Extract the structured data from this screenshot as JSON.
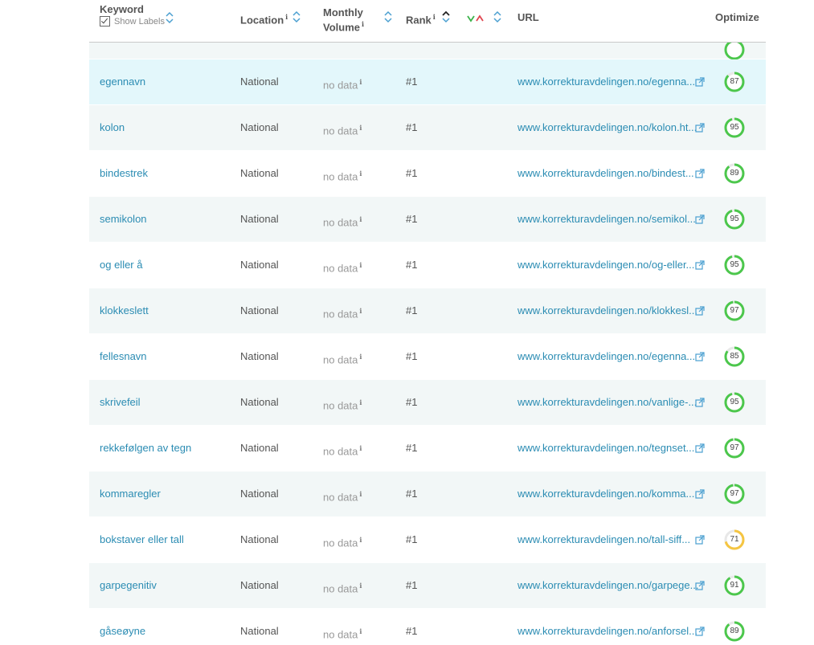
{
  "header": {
    "keyword": "Keyword",
    "show_labels": "Show Labels",
    "location": "Location",
    "monthly_line1": "Monthly",
    "monthly_line2": "Volume",
    "rank": "Rank",
    "url": "URL",
    "optimize": "Optimize",
    "info_glyph": "i"
  },
  "colors": {
    "link": "#2b8cb3",
    "score_green": "#4cc74c",
    "score_yellow": "#f5c542",
    "trend_up": "#3cb34a",
    "trend_down": "#e0454f"
  },
  "rows": [
    {
      "keyword": "egennavn",
      "location": "National",
      "volume": "no data",
      "rank": "#1",
      "url": "www.korrekturavdelingen.no/egenna...",
      "score": 87
    },
    {
      "keyword": "kolon",
      "location": "National",
      "volume": "no data",
      "rank": "#1",
      "url": "www.korrekturavdelingen.no/kolon.ht...",
      "score": 95
    },
    {
      "keyword": "bindestrek",
      "location": "National",
      "volume": "no data",
      "rank": "#1",
      "url": "www.korrekturavdelingen.no/bindest...",
      "score": 89
    },
    {
      "keyword": "semikolon",
      "location": "National",
      "volume": "no data",
      "rank": "#1",
      "url": "www.korrekturavdelingen.no/semikol...",
      "score": 95
    },
    {
      "keyword": "og eller å",
      "location": "National",
      "volume": "no data",
      "rank": "#1",
      "url": "www.korrekturavdelingen.no/og-eller...",
      "score": 95
    },
    {
      "keyword": "klokkeslett",
      "location": "National",
      "volume": "no data",
      "rank": "#1",
      "url": "www.korrekturavdelingen.no/klokkesl...",
      "score": 97
    },
    {
      "keyword": "fellesnavn",
      "location": "National",
      "volume": "no data",
      "rank": "#1",
      "url": "www.korrekturavdelingen.no/egenna...",
      "score": 85
    },
    {
      "keyword": "skrivefeil",
      "location": "National",
      "volume": "no data",
      "rank": "#1",
      "url": "www.korrekturavdelingen.no/vanlige-...",
      "score": 95
    },
    {
      "keyword": "rekkefølgen av tegn",
      "location": "National",
      "volume": "no data",
      "rank": "#1",
      "url": "www.korrekturavdelingen.no/tegnset...",
      "score": 97
    },
    {
      "keyword": "kommaregler",
      "location": "National",
      "volume": "no data",
      "rank": "#1",
      "url": "www.korrekturavdelingen.no/komma...",
      "score": 97
    },
    {
      "keyword": "bokstaver eller tall",
      "location": "National",
      "volume": "no data",
      "rank": "#1",
      "url": "www.korrekturavdelingen.no/tall-siff...",
      "score": 71
    },
    {
      "keyword": "garpegenitiv",
      "location": "National",
      "volume": "no data",
      "rank": "#1",
      "url": "www.korrekturavdelingen.no/garpege...",
      "score": 91
    },
    {
      "keyword": "gåseøyne",
      "location": "National",
      "volume": "no data",
      "rank": "#1",
      "url": "www.korrekturavdelingen.no/anforsel...",
      "score": 89
    }
  ]
}
